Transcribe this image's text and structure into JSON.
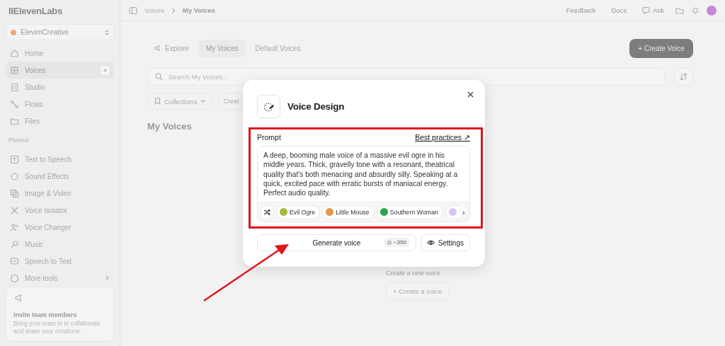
{
  "sidebar": {
    "logo": "IIElevenLabs",
    "workspace": "ElevenCreative",
    "nav": [
      {
        "label": "Home",
        "selected": false,
        "add_button": false
      },
      {
        "label": "Voices",
        "selected": true,
        "add_button": true
      },
      {
        "label": "Studio",
        "selected": false,
        "add_button": false
      },
      {
        "label": "Flows",
        "selected": false,
        "add_button": false
      },
      {
        "label": "Files",
        "selected": false,
        "add_button": false
      }
    ],
    "pinned_heading": "Pinned",
    "pinned": [
      {
        "label": "Text to Speech",
        "selected": false
      },
      {
        "label": "Sound Effects",
        "selected": false
      },
      {
        "label": "Image & Video",
        "selected": false
      },
      {
        "label": "Voice Isolator",
        "selected": false
      },
      {
        "label": "Voice Changer",
        "selected": false
      },
      {
        "label": "Music",
        "selected": false
      },
      {
        "label": "Speech to Text",
        "selected": false
      },
      {
        "label": "More tools",
        "selected": false,
        "submenu": true
      }
    ],
    "invite": {
      "title": "Invite team members",
      "text": "Bring your team in to collaborate and share your creations."
    }
  },
  "top_bar": {
    "breadcrumb": [
      "Voices",
      "My Voices"
    ],
    "actions": [
      {
        "label": "Feedback",
        "kind": "text"
      },
      {
        "label": "Docs",
        "kind": "text"
      },
      {
        "label": "Ask",
        "kind": "chat"
      }
    ]
  },
  "tabs": [
    {
      "label": "Explore",
      "selected": false,
      "kind": "icon"
    },
    {
      "label": "My Voices",
      "selected": true,
      "kind": "text"
    },
    {
      "label": "Default Voices",
      "selected": false,
      "kind": "text"
    }
  ],
  "create_button": "+ Create Voice",
  "search": {
    "placeholder": "Search My Voices..."
  },
  "filters": [
    {
      "label": "Collections",
      "kind": "dropdown"
    },
    {
      "label": "Creat",
      "kind": "plain"
    }
  ],
  "section_title": "My Voices",
  "empty_state": {
    "text": "Create a new voice",
    "button": "+ Create a voice"
  },
  "dialog": {
    "title": "Voice Design",
    "prompt_label": "Prompt",
    "help_link": "Best practices ↗",
    "prompt": "A deep, booming male voice of a massive evil ogre in his middle years. Thick, gravelly tone with a resonant, theatrical quality that's both menacing and absurdly silly. Speaking at a quick, excited pace with erratic bursts of maniacal energy. Perfect audio quality.",
    "presets": [
      {
        "label": "Evil Ogre",
        "color": "#a8b83a"
      },
      {
        "label": "Little Mouse",
        "color": "#e09a4a"
      },
      {
        "label": "Southern Woman",
        "color": "#2aa64a"
      },
      {
        "color": "#d8c6f2"
      }
    ],
    "scroll_arrow": "›",
    "generate_button": "Generate voice",
    "cost": "~350",
    "settings_button": "Settings"
  },
  "annotations": {
    "highlight_frame": true,
    "arrow": true
  }
}
